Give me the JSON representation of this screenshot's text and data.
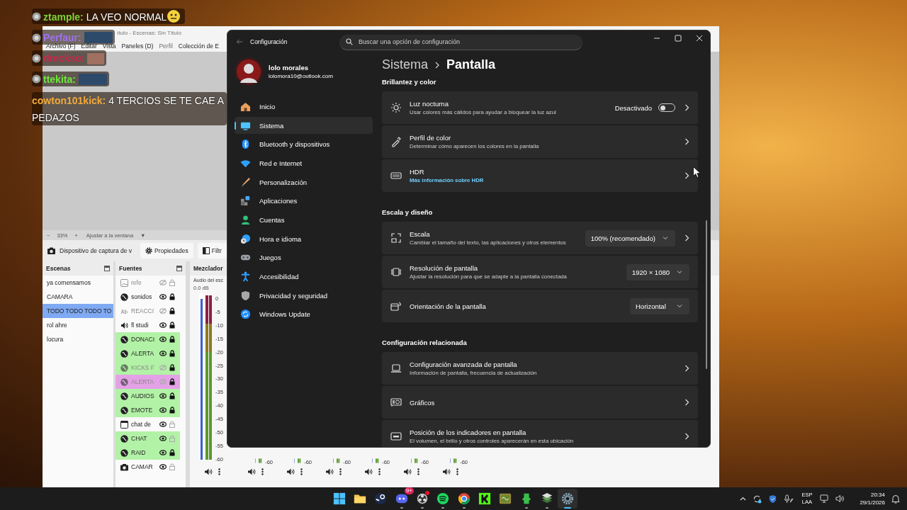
{
  "chat": [
    {
      "user": "ztample:",
      "color": "#7fd13b",
      "badge": true,
      "message": "LA VEO NORMAL",
      "emote": {
        "kind": "emoji"
      }
    },
    {
      "user": "Perfaur:",
      "color": "#a070f0",
      "badge": true,
      "emote": {
        "kind": "image"
      }
    },
    {
      "user": "dreckso:",
      "color": "#c8294a",
      "badge": true,
      "emote": {
        "kind": "image"
      }
    },
    {
      "user": "ttekita:",
      "color": "#6fe83c",
      "badge": true,
      "emote": {
        "kind": "image"
      }
    },
    {
      "user": "cowton101kick:",
      "color": "#f2a93b",
      "badge": false,
      "message": "4 TERCIOS SE TE CAE A PEDAZOS"
    }
  ],
  "obs": {
    "title": "ítulo - Escenas: Sin Título",
    "menu": [
      {
        "label": "Archivo (F)",
        "disabled": false
      },
      {
        "label": "Editar",
        "disabled": false
      },
      {
        "label": "Vista",
        "disabled": false
      },
      {
        "label": "Paneles (D)",
        "disabled": false
      },
      {
        "label": "Perfil",
        "disabled": true
      },
      {
        "label": "Colección de E",
        "disabled": false
      }
    ],
    "zoom_bar": {
      "minus": "−",
      "zoom": "33%",
      "plus": "+",
      "fit": "Ajustar a la ventana",
      "dropdown": "▼"
    },
    "source_toolbar": {
      "source": "Dispositivo de captura de v",
      "buttons": [
        "Propiedades",
        "Filtr"
      ]
    },
    "scenes": {
      "title": "Escenas",
      "items": [
        {
          "label": "ya comensamos",
          "selected": false
        },
        {
          "label": "CAMARA",
          "selected": false
        },
        {
          "label": "TODO TODO TODO TO",
          "selected": true
        },
        {
          "label": "rol ahre",
          "selected": false
        },
        {
          "label": "locura",
          "selected": false
        }
      ]
    },
    "sources": {
      "title": "Fuentes",
      "items": [
        {
          "name": "refe",
          "kind": "image",
          "visible": false,
          "locked": false
        },
        {
          "name": "sonidos",
          "kind": "browser",
          "visible": true,
          "locked": true
        },
        {
          "name": "REACCI",
          "kind": "text",
          "visible": false,
          "locked": true
        },
        {
          "name": "fl studi",
          "kind": "audio",
          "visible": true,
          "locked": true
        },
        {
          "name": "DONACI",
          "kind": "browser",
          "visible": true,
          "locked": true,
          "color": "#b2f2a6"
        },
        {
          "name": "ALERTA",
          "kind": "browser",
          "visible": true,
          "locked": true,
          "color": "#b2f2a6"
        },
        {
          "name": "KICKS F",
          "kind": "browser",
          "visible": false,
          "locked": true,
          "color": "#b2f2a6"
        },
        {
          "name": "ALERTA",
          "kind": "browser",
          "visible": false,
          "locked": true,
          "color": "#e4a2e6"
        },
        {
          "name": "AUDIOS",
          "kind": "browser",
          "visible": true,
          "locked": true,
          "color": "#b2f2a6"
        },
        {
          "name": "EMOTE",
          "kind": "browser",
          "visible": true,
          "locked": true,
          "color": "#b2f2a6"
        },
        {
          "name": "chat de",
          "kind": "window",
          "visible": true,
          "locked": false
        },
        {
          "name": "CHAT",
          "kind": "browser",
          "visible": true,
          "locked": false,
          "color": "#b2f2a6"
        },
        {
          "name": "RAID",
          "kind": "browser",
          "visible": true,
          "locked": true,
          "color": "#b2f2a6"
        },
        {
          "name": "CAMAR",
          "kind": "camera",
          "visible": true,
          "locked": false
        }
      ]
    },
    "mixer": {
      "title": "Mezclador",
      "channels": [
        {
          "name": "Audio del esc",
          "db": "0.0 dB",
          "level": 1,
          "scale": [
            "0",
            "-5",
            "-10",
            "-15",
            "-20",
            "-25",
            "-30",
            "-35",
            "-40",
            "-45",
            "-50",
            "-55",
            "-60"
          ]
        },
        {
          "scale": [
            "-60"
          ]
        },
        {
          "scale": [
            "-60"
          ]
        },
        {
          "scale": [
            "-60"
          ]
        },
        {
          "scale": [
            "-60"
          ]
        },
        {
          "scale": [
            "-60"
          ]
        },
        {
          "scale": [
            "-60"
          ]
        }
      ]
    }
  },
  "settings": {
    "title": "Configuración",
    "search": {
      "placeholder": "Buscar una opción de configuración"
    },
    "account": {
      "name": "lolo morales",
      "email": "lolomora10@outlook.com"
    },
    "nav": [
      {
        "label": "Inicio",
        "selected": false
      },
      {
        "label": "Sistema",
        "selected": true
      },
      {
        "label": "Bluetooth y dispositivos",
        "selected": false
      },
      {
        "label": "Red e Internet",
        "selected": false
      },
      {
        "label": "Personalización",
        "selected": false
      },
      {
        "label": "Aplicaciones",
        "selected": false
      },
      {
        "label": "Cuentas",
        "selected": false
      },
      {
        "label": "Hora e idioma",
        "selected": false
      },
      {
        "label": "Juegos",
        "selected": false
      },
      {
        "label": "Accesibilidad",
        "selected": false
      },
      {
        "label": "Privacidad y seguridad",
        "selected": false
      },
      {
        "label": "Windows Update",
        "selected": false
      }
    ],
    "breadcrumb": {
      "parent": "Sistema",
      "current": "Pantalla"
    },
    "sections": [
      {
        "title": "Brillantez y color",
        "rows": [
          {
            "kind": "toggle",
            "title": "Luz nocturna",
            "subtitle": "Usar colores más cálidos para ayudar a bloquear la luz azul",
            "status": "Desactivado",
            "on": false,
            "navigates": true
          },
          {
            "kind": "link",
            "title": "Perfil de color",
            "subtitle": "Determinar cómo aparecen los colores en la pantalla",
            "navigates": true
          },
          {
            "kind": "link",
            "title": "HDR",
            "link": "Más información sobre HDR",
            "navigates": true
          }
        ]
      },
      {
        "title": "Escala y diseño",
        "rows": [
          {
            "kind": "dropdown",
            "title": "Escala",
            "subtitle": "Cambiar el tamaño del texto, las aplicaciones y otros elementos",
            "value": "100% (recomendado)",
            "navigates": true
          },
          {
            "kind": "dropdown",
            "title": "Resolución de pantalla",
            "subtitle": "Ajustar la resolución para que se adapte a la pantalla conectada",
            "value": "1920 × 1080",
            "navigates": false
          },
          {
            "kind": "dropdown",
            "title": "Orientación de la pantalla",
            "value": "Horizontal",
            "navigates": false
          }
        ]
      },
      {
        "title": "Configuración relacionada",
        "rows": [
          {
            "kind": "link",
            "title": "Configuración avanzada de pantalla",
            "subtitle": "Información de pantalla, frecuencia de actualización",
            "navigates": true
          },
          {
            "kind": "link",
            "title": "Gráficos",
            "navigates": true
          },
          {
            "kind": "link",
            "title": "Posición de los indicadores en pantalla",
            "subtitle": "El volumen, el brillo y otros controles aparecerán en esta ubicación",
            "navigates": true
          }
        ]
      }
    ]
  },
  "taskbar": {
    "apps": [
      {
        "running": false,
        "selected": false,
        "alert": false
      },
      {
        "running": false,
        "selected": false,
        "alert": false
      },
      {
        "running": false,
        "selected": false,
        "alert": false
      },
      {
        "running": true,
        "selected": false,
        "alert": false,
        "badge": "9+"
      },
      {
        "running": true,
        "selected": false,
        "alert": true
      },
      {
        "running": true,
        "selected": false,
        "alert": false
      },
      {
        "running": true,
        "selected": false,
        "alert": false
      },
      {
        "running": false,
        "selected": false,
        "alert": false
      },
      {
        "running": false,
        "selected": false,
        "alert": false
      },
      {
        "running": true,
        "selected": false,
        "alert": false
      },
      {
        "running": true,
        "selected": false,
        "alert": false
      },
      {
        "running": true,
        "selected": true,
        "alert": false
      }
    ],
    "tray": {
      "language": "ESP",
      "layout": "LAA",
      "time": "20:34",
      "date": "29/1/2026"
    }
  }
}
